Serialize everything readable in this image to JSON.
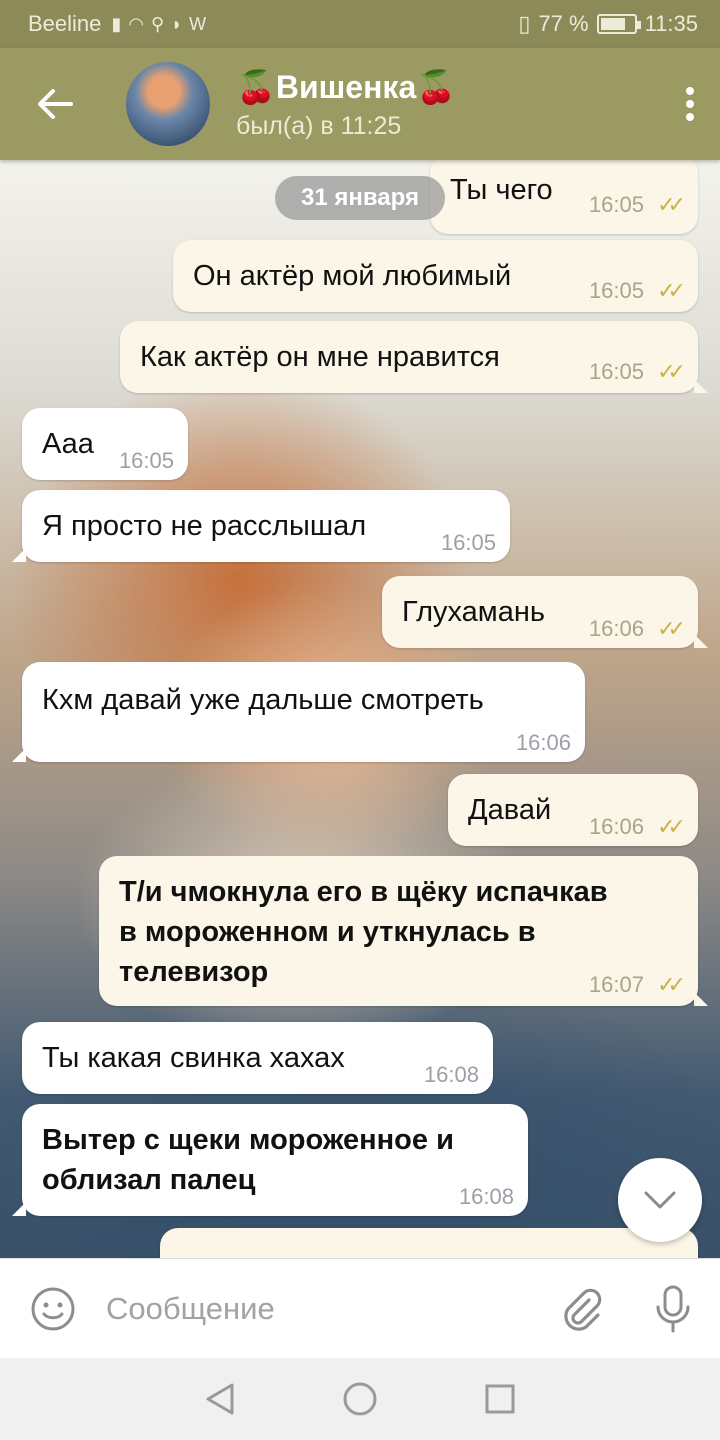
{
  "status_bar": {
    "carrier": "Beeline",
    "battery": "77 %",
    "battery_level": 0.77,
    "time": "11:35"
  },
  "header": {
    "title": "🍒Вишенка🍒",
    "status": "был(а) в 11:25",
    "icons": [
      "back-arrow-icon",
      "avatar",
      "more-vert-icon"
    ]
  },
  "chat": {
    "date_pill": "31 января",
    "messages": [
      {
        "text": "Ты чего",
        "time": "16:05",
        "dir": "out"
      },
      {
        "text": "Он актёр мой любимый",
        "time": "16:05",
        "dir": "out"
      },
      {
        "text": "Как актёр он мне нравится",
        "time": "16:05",
        "dir": "out"
      },
      {
        "text": "Ааа",
        "time": "16:05",
        "dir": "in"
      },
      {
        "text": "Я просто не расслышал",
        "time": "16:05",
        "dir": "in"
      },
      {
        "text": "Глухамань",
        "time": "16:06",
        "dir": "out"
      },
      {
        "text": "Кхм давай уже дальше смотреть",
        "time": "16:06",
        "dir": "in"
      },
      {
        "text": "Давай",
        "time": "16:06",
        "dir": "out"
      },
      {
        "line1": "Т/и чмокнула его в щёку испачкав",
        "line2": "в мороженном и уткнулась в",
        "line3": "телевизор",
        "time": "16:07",
        "dir": "out"
      },
      {
        "text": "Ты какая свинка хахах",
        "time": "16:08",
        "dir": "in"
      },
      {
        "line1": "Вытер с щеки мороженное и",
        "line2": "облизал палец",
        "time": "16:08",
        "dir": "in"
      }
    ],
    "checkmark": "✓✓"
  },
  "input_bar": {
    "placeholder": "Сообщение",
    "icons": [
      "emoji-icon",
      "attach-icon",
      "mic-icon"
    ]
  },
  "nav_bar": {
    "icons": [
      "back-triangle-icon",
      "home-circle-icon",
      "recents-square-icon"
    ]
  },
  "colors": {
    "header_bg": "#9a9a62",
    "status_bg": "#8c8a58",
    "bubble_out": "#fbf6e7",
    "bubble_in": "#ffffff",
    "check": "#c8b24a"
  }
}
